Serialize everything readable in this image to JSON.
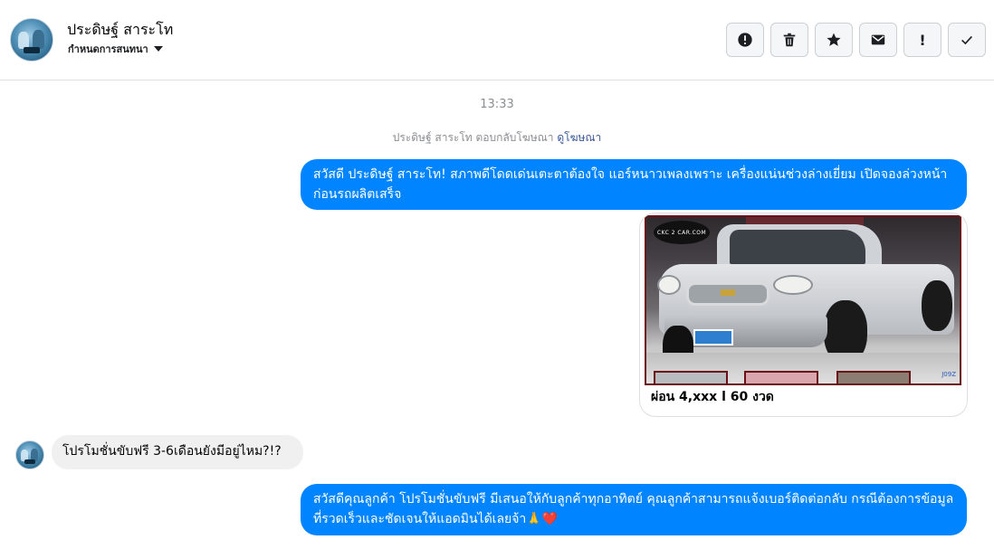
{
  "header": {
    "contact_name": "ประดิษฐ์ สาระโท",
    "conversation_setting": "กำหนดการสนทนา",
    "actions": [
      {
        "name": "report-icon"
      },
      {
        "name": "trash-icon"
      },
      {
        "name": "star-icon"
      },
      {
        "name": "envelope-icon"
      },
      {
        "name": "mark-important-icon",
        "glyph": "!"
      },
      {
        "name": "check-icon"
      }
    ]
  },
  "thread": {
    "timestamp": "13:33",
    "reply_note": "ประดิษฐ์ สาระโท ตอบกลับโฆษณา",
    "reply_note_link": "ดูโฆษณา",
    "messages": [
      {
        "direction": "outgoing",
        "text": "สวัสดี ประดิษฐ์ สาระโท! สภาพดีโดดเด่นเตะตาต้องใจ แอร์หนาวเพลงเพราะ เครื่องแน่นช่วงล่างเยี่ยม เปิดจองล่วงหน้าก่อนรถผลิตเสร็จ"
      },
      {
        "direction": "outgoing",
        "type": "ad-card",
        "caption": "ผ่อน 4,xxx l 60 งวด",
        "photo_logo": "CKC 2 CAR.COM",
        "photo_code": "J09Z"
      },
      {
        "direction": "incoming",
        "text": "โปรโมชั่นขับฟรี 3-6เดือนยังมีอยู่ไหม?!?"
      },
      {
        "direction": "outgoing",
        "text": "สวัสดีคุณลูกค้า โปรโมชั่นขับฟรี มีเสนอให้กับลูกค้าทุกอาทิตย์ คุณลูกค้าสามารถแจ้งเบอร์ติดต่อกลับ กรณีต้องการข้อมูลที่รวดเร็วและชัดเจนให้แอดมินได้เลยจ้า🙏❤️"
      }
    ]
  },
  "colors": {
    "outgoing_bubble": "#0084ff",
    "incoming_bubble": "#f1f0f0",
    "link": "#385898"
  }
}
